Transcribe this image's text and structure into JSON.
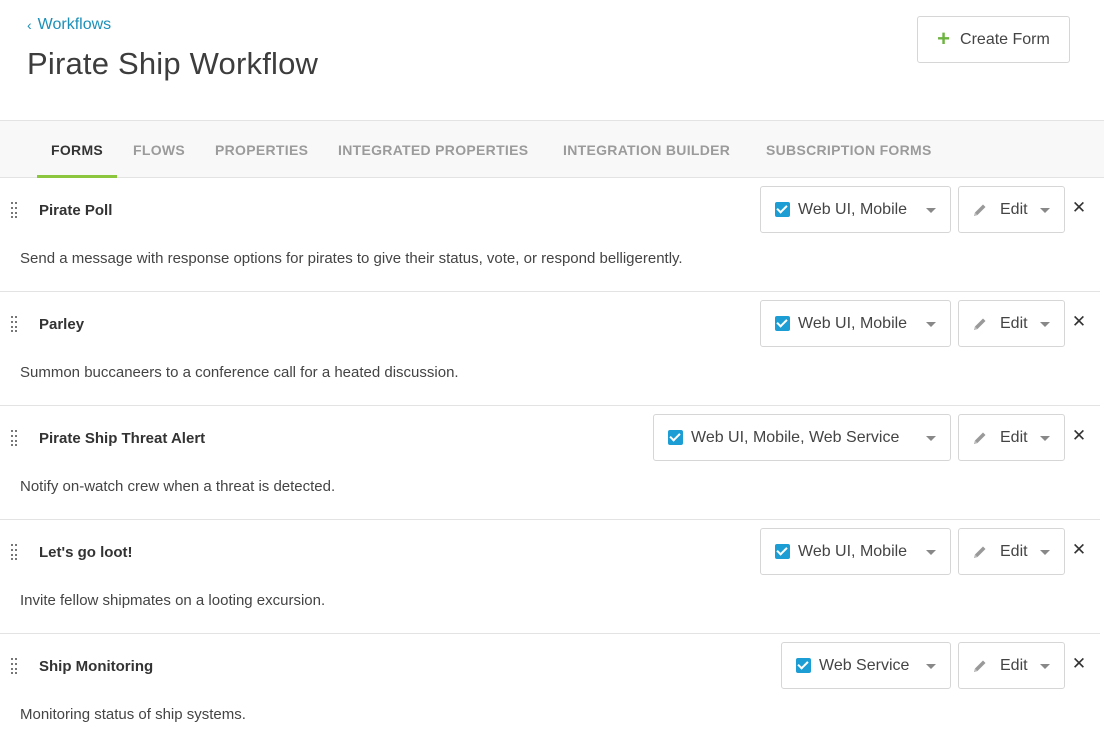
{
  "header": {
    "back_label": "Workflows",
    "title": "Pirate Ship Workflow",
    "create_label": "Create Form"
  },
  "tabs": [
    {
      "label": "FORMS",
      "active": true
    },
    {
      "label": "FLOWS",
      "active": false
    },
    {
      "label": "PROPERTIES",
      "active": false
    },
    {
      "label": "INTEGRATED PROPERTIES",
      "active": false
    },
    {
      "label": "INTEGRATION BUILDER",
      "active": false
    },
    {
      "label": "SUBSCRIPTION FORMS",
      "active": false
    }
  ],
  "forms": [
    {
      "title": "Pirate Poll",
      "description": "Send a message with response options for pirates to give their status, vote, or respond belligerently.",
      "channels": "Web UI, Mobile",
      "checked": true,
      "edit_label": "Edit"
    },
    {
      "title": "Parley",
      "description": "Summon buccaneers to a conference call for a heated discussion.",
      "channels": "Web UI, Mobile",
      "checked": true,
      "edit_label": "Edit"
    },
    {
      "title": "Pirate Ship Threat Alert",
      "description": "Notify on-watch crew when a threat is detected.",
      "channels": "Web UI, Mobile, Web Service",
      "checked": true,
      "edit_label": "Edit"
    },
    {
      "title": "Let's go loot!",
      "description": "Invite fellow shipmates on a looting excursion.",
      "channels": "Web UI, Mobile",
      "checked": true,
      "edit_label": "Edit"
    },
    {
      "title": "Ship Monitoring",
      "description": "Monitoring status of ship systems.",
      "channels": "Web Service",
      "checked": true,
      "edit_label": "Edit"
    }
  ],
  "colors": {
    "accent": "#1c9ed4",
    "tab_underline": "#8cc63f",
    "plus": "#6db33f",
    "link": "#1c8fb8"
  },
  "icons": {
    "back": "chevron-left-icon",
    "create": "plus-icon",
    "drag": "drag-handle-icon",
    "checkbox": "checkbox-checked-icon",
    "dropdown": "caret-down-icon",
    "edit": "pencil-icon",
    "delete": "close-icon"
  }
}
